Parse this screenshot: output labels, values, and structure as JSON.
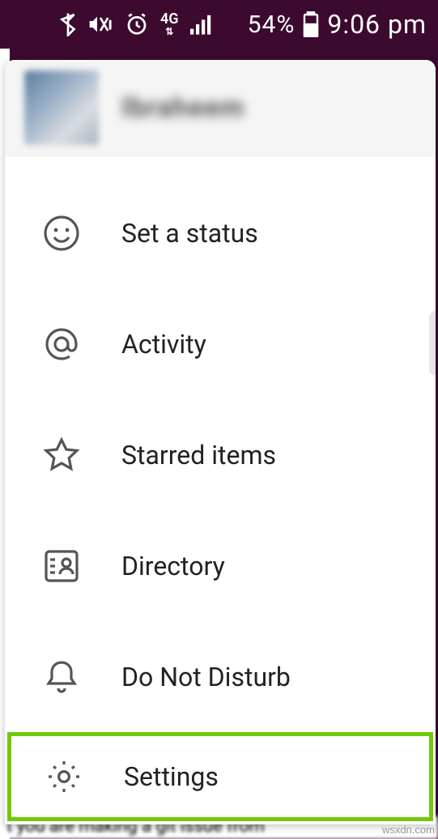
{
  "status_bar": {
    "battery_pct": "54%",
    "time": "9:06 pm",
    "network_label": "4G"
  },
  "profile": {
    "username": "Ibraheem"
  },
  "menu": {
    "items": [
      {
        "label": "Set a status",
        "icon": "smile-icon"
      },
      {
        "label": "Activity",
        "icon": "at-icon"
      },
      {
        "label": "Starred items",
        "icon": "star-icon"
      },
      {
        "label": "Directory",
        "icon": "directory-icon"
      },
      {
        "label": "Do Not Disturb",
        "icon": "bell-icon"
      },
      {
        "label": "Settings",
        "icon": "gear-icon",
        "highlighted": true
      }
    ]
  },
  "watermark": "wsxdn.com"
}
